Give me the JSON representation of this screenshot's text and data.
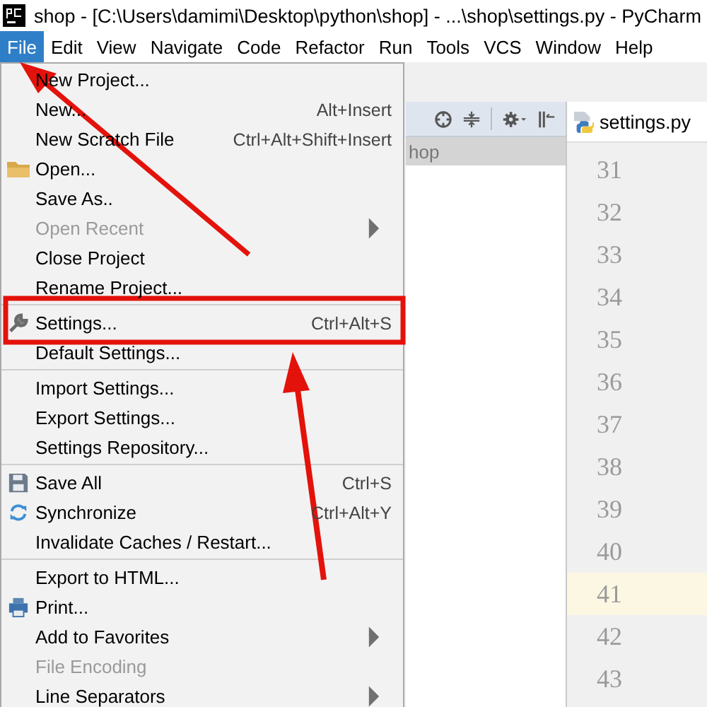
{
  "window": {
    "title": "shop - [C:\\Users\\damimi\\Desktop\\python\\shop] - ...\\shop\\settings.py - PyCharm"
  },
  "menus": [
    {
      "label": "File",
      "selected": true
    },
    {
      "label": "Edit",
      "selected": false
    },
    {
      "label": "View",
      "selected": false
    },
    {
      "label": "Navigate",
      "selected": false
    },
    {
      "label": "Code",
      "selected": false
    },
    {
      "label": "Refactor",
      "selected": false
    },
    {
      "label": "Run",
      "selected": false
    },
    {
      "label": "Tools",
      "selected": false
    },
    {
      "label": "VCS",
      "selected": false
    },
    {
      "label": "Window",
      "selected": false
    },
    {
      "label": "Help",
      "selected": false
    }
  ],
  "file_menu": [
    {
      "kind": "item",
      "label": "New Project...",
      "disabled": false,
      "submenu": false
    },
    {
      "kind": "item",
      "label": "New...",
      "shortcut": "Alt+Insert",
      "disabled": false,
      "submenu": false
    },
    {
      "kind": "item",
      "label": "New Scratch File",
      "shortcut": "Ctrl+Alt+Shift+Insert",
      "disabled": false,
      "submenu": false
    },
    {
      "kind": "item",
      "label": "Open...",
      "disabled": false,
      "submenu": false
    },
    {
      "kind": "item",
      "label": "Save As..",
      "disabled": false,
      "submenu": false
    },
    {
      "kind": "item",
      "label": "Open Recent",
      "disabled": true,
      "submenu": true
    },
    {
      "kind": "item",
      "label": "Close Project",
      "disabled": false,
      "submenu": false
    },
    {
      "kind": "item",
      "label": "Rename Project...",
      "disabled": false,
      "submenu": false
    },
    {
      "kind": "separator"
    },
    {
      "kind": "item",
      "label": "Settings...",
      "shortcut": "Ctrl+Alt+S",
      "disabled": false,
      "submenu": false
    },
    {
      "kind": "item",
      "label": "Default Settings...",
      "disabled": false,
      "submenu": false
    },
    {
      "kind": "separator"
    },
    {
      "kind": "item",
      "label": "Import Settings...",
      "disabled": false,
      "submenu": false
    },
    {
      "kind": "item",
      "label": "Export Settings...",
      "disabled": false,
      "submenu": false
    },
    {
      "kind": "item",
      "label": "Settings Repository...",
      "disabled": false,
      "submenu": false
    },
    {
      "kind": "separator"
    },
    {
      "kind": "item",
      "label": "Save All",
      "shortcut": "Ctrl+S",
      "disabled": false,
      "submenu": false
    },
    {
      "kind": "item",
      "label": "Synchronize",
      "shortcut": "Ctrl+Alt+Y",
      "disabled": false,
      "submenu": false
    },
    {
      "kind": "item",
      "label": "Invalidate Caches / Restart...",
      "disabled": false,
      "submenu": false
    },
    {
      "kind": "separator"
    },
    {
      "kind": "item",
      "label": "Export to HTML...",
      "disabled": false,
      "submenu": false
    },
    {
      "kind": "item",
      "label": "Print...",
      "disabled": false,
      "submenu": false
    },
    {
      "kind": "item",
      "label": "Add to Favorites",
      "disabled": false,
      "submenu": true
    },
    {
      "kind": "item",
      "label": "File Encoding",
      "disabled": true,
      "submenu": false
    },
    {
      "kind": "item",
      "label": "Line Separators",
      "disabled": false,
      "submenu": true
    }
  ],
  "project_panel": {
    "header": "hop"
  },
  "editor": {
    "tab": "settings.py",
    "lines": [
      {
        "number": "31",
        "current": false
      },
      {
        "number": "32",
        "current": false
      },
      {
        "number": "33",
        "current": false
      },
      {
        "number": "34",
        "current": false
      },
      {
        "number": "35",
        "current": false
      },
      {
        "number": "36",
        "current": false
      },
      {
        "number": "37",
        "current": false
      },
      {
        "number": "38",
        "current": false
      },
      {
        "number": "39",
        "current": false
      },
      {
        "number": "40",
        "current": false
      },
      {
        "number": "41",
        "current": true
      },
      {
        "number": "42",
        "current": false
      },
      {
        "number": "43",
        "current": false
      }
    ]
  }
}
